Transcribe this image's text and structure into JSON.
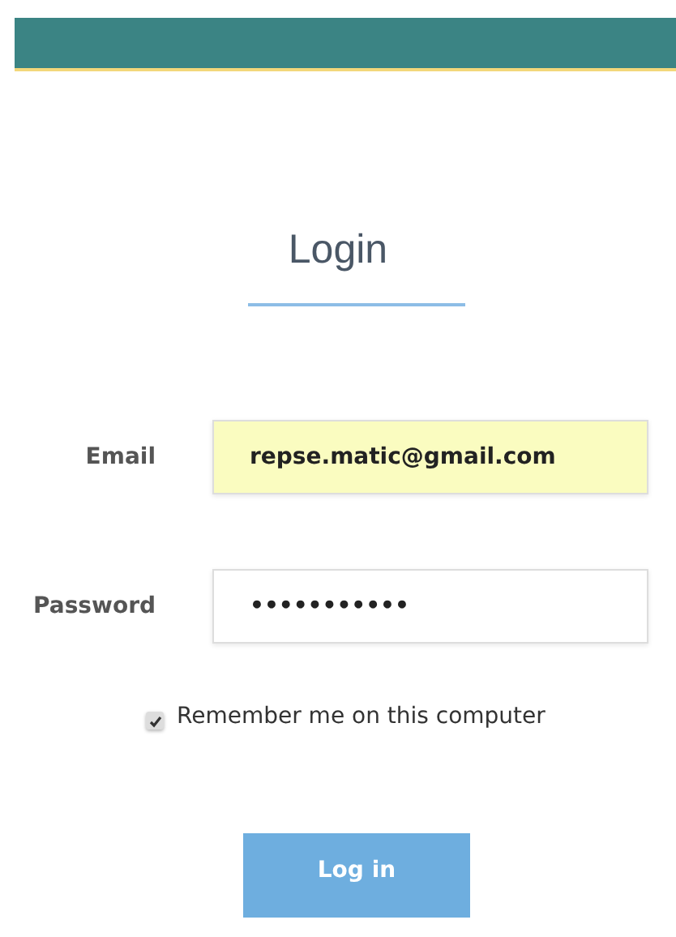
{
  "title": "Login",
  "fields": [
    {
      "label": "Email",
      "value": "repse.matic@gmail.com",
      "autofilled": true
    },
    {
      "label": "Password",
      "value": "•••••••••••",
      "autofilled": false
    }
  ],
  "remember": {
    "label": "Remember me on this computer",
    "checked": true
  },
  "button": "Log in"
}
